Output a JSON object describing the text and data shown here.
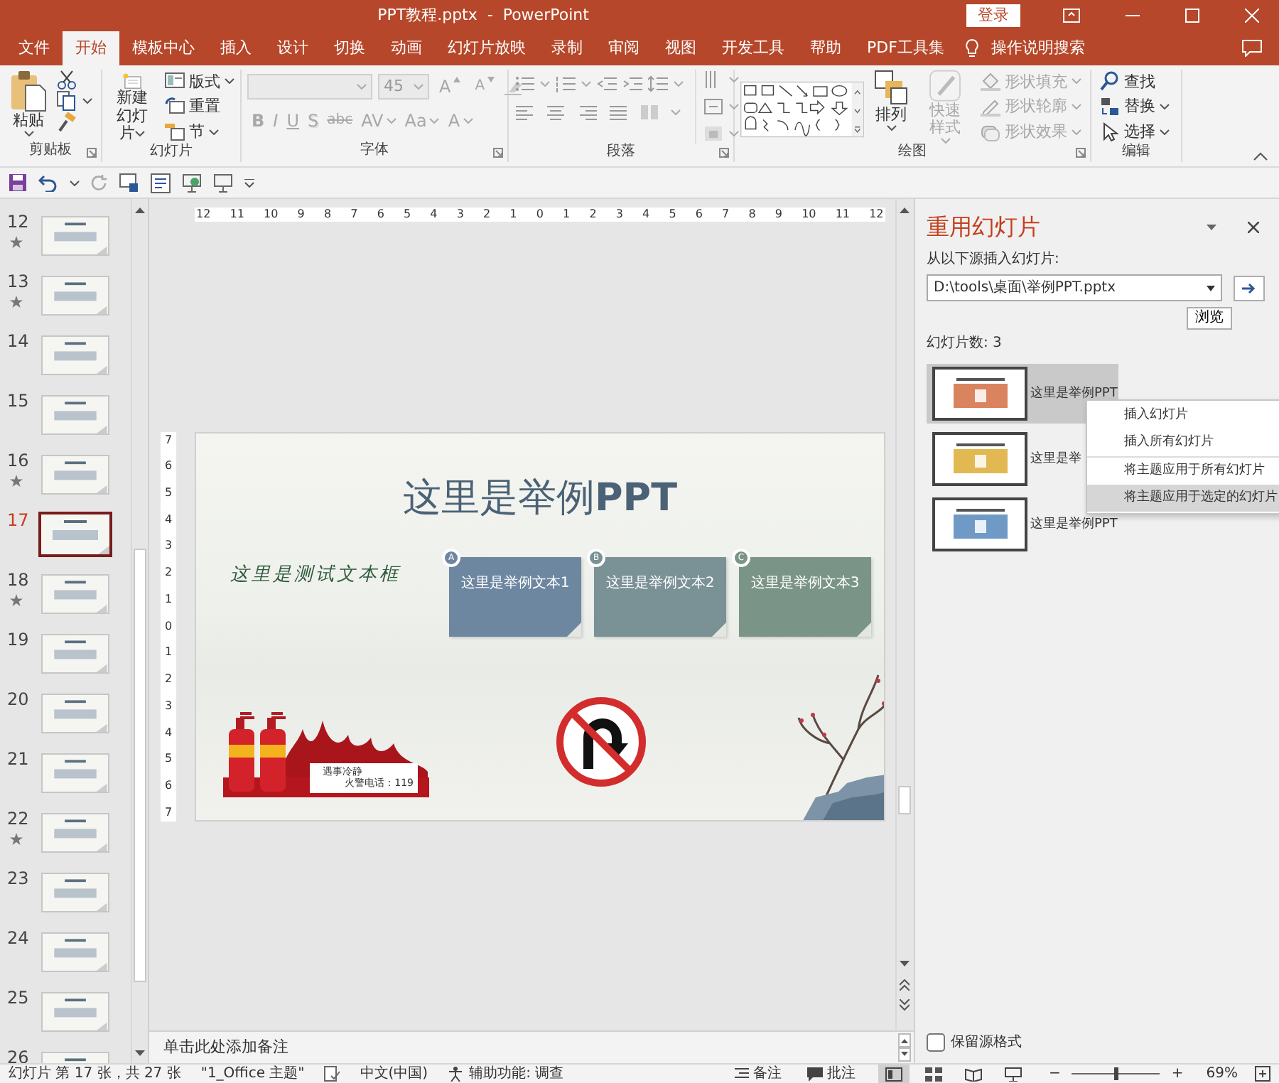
{
  "window": {
    "title": "PPT教程.pptx  -  PowerPoint",
    "login_button": "登录"
  },
  "tabs": [
    {
      "label": "文件",
      "selected": false
    },
    {
      "label": "开始",
      "selected": true
    },
    {
      "label": "模板中心",
      "selected": false
    },
    {
      "label": "插入",
      "selected": false
    },
    {
      "label": "设计",
      "selected": false
    },
    {
      "label": "切换",
      "selected": false
    },
    {
      "label": "动画",
      "selected": false
    },
    {
      "label": "幻灯片放映",
      "selected": false
    },
    {
      "label": "录制",
      "selected": false
    },
    {
      "label": "审阅",
      "selected": false
    },
    {
      "label": "视图",
      "selected": false
    },
    {
      "label": "开发工具",
      "selected": false
    },
    {
      "label": "帮助",
      "selected": false
    },
    {
      "label": "PDF工具集",
      "selected": false
    }
  ],
  "tell_me": "操作说明搜索",
  "ribbon": {
    "clipboard": {
      "paste": "粘贴",
      "label": "剪贴板"
    },
    "slides": {
      "new_slide": [
        "新建",
        "幻灯片"
      ],
      "buttons": [
        "版式",
        "重置",
        "节"
      ],
      "label": "幻灯片"
    },
    "font": {
      "size": "45",
      "buttons": [
        {
          "label": "A",
          "disabled": true
        },
        {
          "label": "A",
          "disabled": true
        },
        {
          "label": "B",
          "disabled": true
        },
        {
          "label": "I",
          "disabled": true
        },
        {
          "label": "U",
          "disabled": true
        },
        {
          "label": "S",
          "disabled": true
        },
        {
          "label": "abc",
          "disabled": true
        },
        {
          "label": "AV",
          "disabled": true
        },
        {
          "label": "Aa",
          "disabled": true
        },
        {
          "label": "A",
          "disabled": true
        }
      ],
      "label": "字体"
    },
    "paragraph": {
      "label": "段落"
    },
    "drawing": {
      "arrange": "排列",
      "quick_styles": {
        "label": "快速样式",
        "disabled": true
      },
      "buttons": [
        {
          "label": "形状填充",
          "disabled": true
        },
        {
          "label": "形状轮廓",
          "disabled": true
        },
        {
          "label": "形状效果",
          "disabled": true
        }
      ],
      "label": "绘图"
    },
    "editing": {
      "buttons": [
        "查找",
        "替换",
        "选择"
      ],
      "label": "编辑"
    }
  },
  "thumbnails": [
    {
      "number": "12",
      "starred": true,
      "selected": false
    },
    {
      "number": "13",
      "starred": true,
      "selected": false
    },
    {
      "number": "14",
      "starred": false,
      "selected": false
    },
    {
      "number": "15",
      "starred": false,
      "selected": false
    },
    {
      "number": "16",
      "starred": true,
      "selected": false
    },
    {
      "number": "17",
      "starred": false,
      "selected": true
    },
    {
      "number": "18",
      "starred": true,
      "selected": false
    },
    {
      "number": "19",
      "starred": false,
      "selected": false
    },
    {
      "number": "20",
      "starred": false,
      "selected": false
    },
    {
      "number": "21",
      "starred": false,
      "selected": false
    },
    {
      "number": "22",
      "starred": true,
      "selected": false
    },
    {
      "number": "23",
      "starred": false,
      "selected": false
    },
    {
      "number": "24",
      "starred": false,
      "selected": false
    },
    {
      "number": "25",
      "starred": false,
      "selected": false
    },
    {
      "number": "26",
      "starred": false,
      "selected": false
    }
  ],
  "rulers": {
    "horizontal": [
      "12",
      "11",
      "10",
      "9",
      "8",
      "7",
      "6",
      "5",
      "4",
      "3",
      "2",
      "1",
      "0",
      "1",
      "2",
      "3",
      "4",
      "5",
      "6",
      "7",
      "8",
      "9",
      "10",
      "11",
      "12"
    ],
    "vertical": [
      "7",
      "6",
      "5",
      "4",
      "3",
      "2",
      "1",
      "0",
      "1",
      "2",
      "3",
      "4",
      "5",
      "6",
      "7"
    ]
  },
  "slide": {
    "title": "这里是举例**PPT**",
    "handwriting": "这里是测试文本框",
    "cards": [
      {
        "marker": "A",
        "text": "这里是举例文本1",
        "color": "#6d87a1"
      },
      {
        "marker": "B",
        "text": "这里是举例文本2",
        "color": "#7a9196"
      },
      {
        "marker": "C",
        "text": "这里是举例文本3",
        "color": "#7a9587"
      }
    ],
    "poster": {
      "slogan": "遇事冷静",
      "phone": "火警电话：119"
    }
  },
  "notes_placeholder": "单击此处添加备注",
  "reuse_pane": {
    "title": "重用幻灯片",
    "source_label": "从以下源插入幻灯片:",
    "source_path": "D:\\tools\\桌面\\举例PPT.pptx",
    "browse": "浏览",
    "count": "幻灯片数: 3",
    "slides": [
      {
        "title": "这里是举例PPT",
        "color": "#d9845e",
        "selected": true
      },
      {
        "title": "这里是举",
        "color": "#e2b852",
        "selected": false
      },
      {
        "title": "这里是举例PPT",
        "color": "#6f9ac6",
        "selected": false
      }
    ],
    "keep_formatting": {
      "label": "保留源格式",
      "checked": false
    }
  },
  "context_menu": [
    {
      "label": "插入幻灯片",
      "group_start": false,
      "selected": false
    },
    {
      "label": "插入所有幻灯片",
      "group_start": false,
      "selected": false
    },
    {
      "label": "将主题应用于所有幻灯片",
      "group_start": true,
      "selected": false
    },
    {
      "label": "将主题应用于选定的幻灯片",
      "group_start": false,
      "selected": true
    }
  ],
  "status_bar": {
    "slide_info": "幻灯片 第 17 张，共 27 张",
    "theme": "\"1_Office 主题\"",
    "language": "中文(中国)",
    "accessibility": "辅助功能: 调查",
    "notes": "备注",
    "comments": "批注",
    "views": [
      {
        "selected": true
      },
      {
        "selected": false
      },
      {
        "selected": false
      },
      {
        "selected": false
      }
    ],
    "zoom_out": "−",
    "zoom_slider": {
      "level": 0.5
    },
    "zoom_in": "+",
    "zoom": "69%"
  }
}
